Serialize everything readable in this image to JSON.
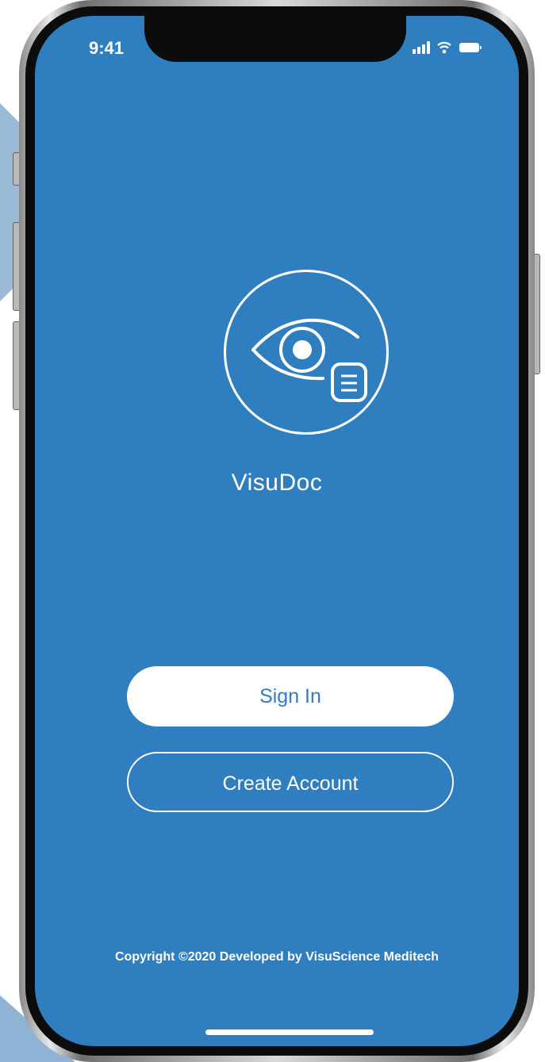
{
  "status_bar": {
    "time": "9:41",
    "icons": [
      "signal-icon",
      "wifi-icon",
      "battery-icon"
    ]
  },
  "app": {
    "logo_icon": "eye-document-icon",
    "name": "VisuDoc"
  },
  "buttons": {
    "sign_in": "Sign In",
    "create_account": "Create Account"
  },
  "footer": {
    "copyright": "Copyright ©2020 Developed by VisuScience Meditech"
  },
  "colors": {
    "screen_background": "#2f7ebf",
    "foreground": "#ffffff",
    "decor_accent": "#8fb3d4"
  }
}
